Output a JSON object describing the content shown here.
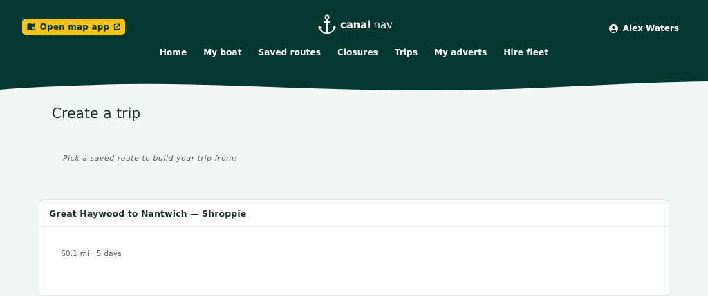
{
  "header": {
    "map_button": {
      "label": "Open map app",
      "icon": "map-icon",
      "external_icon": "external-link-icon"
    },
    "logo": {
      "bold": "canal",
      "light": " nav",
      "icon": "anchor-icon"
    },
    "user": {
      "name": "Alex Waters",
      "icon": "user-circle-icon"
    },
    "nav": [
      "Home",
      "My boat",
      "Saved routes",
      "Closures",
      "Trips",
      "My adverts",
      "Hire fleet"
    ]
  },
  "main": {
    "title": "Create a trip",
    "hint": "Pick a saved route to build your trip from:",
    "routes": [
      {
        "name": "Great Haywood to Nantwich — Shroppie",
        "meta": "60.1 mi · 5 days"
      }
    ]
  },
  "colors": {
    "header_bg": "#033830",
    "accent_yellow": "#f3c21b",
    "page_bg": "#f2f6f5"
  }
}
